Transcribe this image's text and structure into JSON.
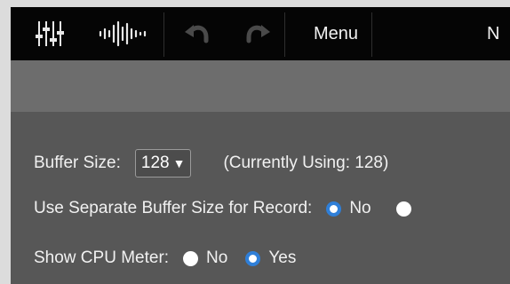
{
  "toolbar": {
    "icons": [
      "mixer-icon",
      "waveform-icon",
      "undo-icon",
      "redo-icon"
    ],
    "menu_label": "Menu",
    "cut_label": "N"
  },
  "settings": {
    "buffer_size": {
      "label": "Buffer Size:",
      "value": "128",
      "current": "(Currently Using: 128)"
    },
    "separate_buffer": {
      "label": "Use Separate Buffer Size for Record:",
      "options": [
        {
          "label": "No",
          "selected": true
        },
        {
          "label": "",
          "selected": false
        }
      ]
    },
    "cpu_meter": {
      "label": "Show CPU Meter:",
      "options": [
        {
          "label": "No",
          "selected": false
        },
        {
          "label": "Yes",
          "selected": true
        }
      ]
    }
  },
  "colors": {
    "radio_selected": "#2f7fd8",
    "toolbar_bg": "#050505",
    "panel_bg": "#575757"
  }
}
